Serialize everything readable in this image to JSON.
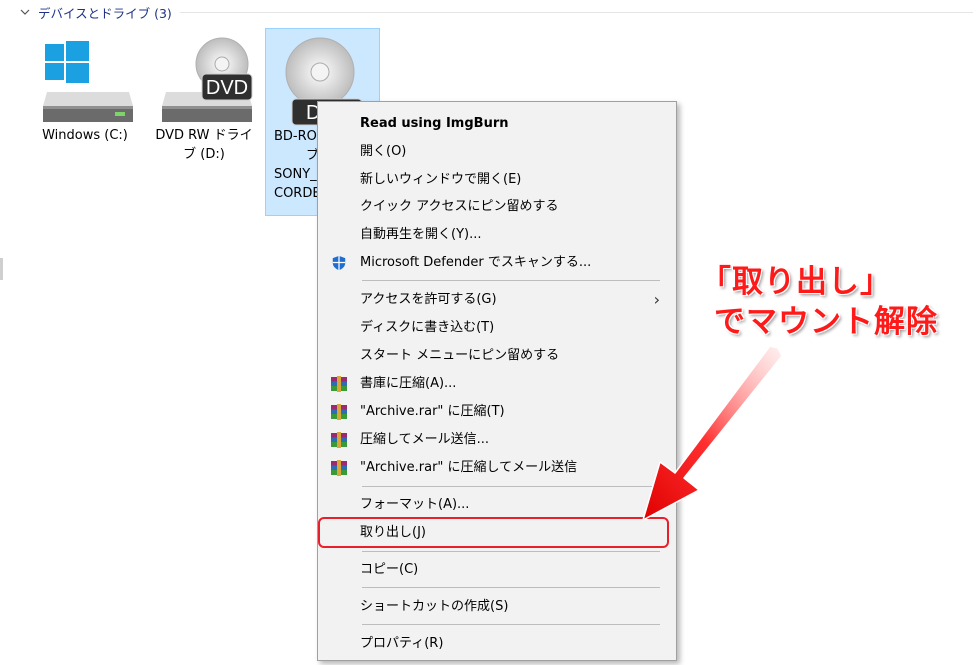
{
  "section": {
    "title": "デバイスとドライブ (3)"
  },
  "drives": [
    {
      "label": "Windows (C:)"
    },
    {
      "label": "DVD RW ドライブ (D:)",
      "badge": "DVD"
    },
    {
      "label": "BD-ROM ドライブ SONY_ RECORDER",
      "visible_label": [
        "BD-RO",
        "ブ",
        "SONY_",
        "CORDE"
      ],
      "badge": "D"
    }
  ],
  "context_menu": {
    "items": [
      {
        "label": "Read using ImgBurn",
        "bold": true
      },
      {
        "label": "開く(O)"
      },
      {
        "label": "新しいウィンドウで開く(E)"
      },
      {
        "label": "クイック アクセスにピン留めする"
      },
      {
        "label": "自動再生を開く(Y)..."
      },
      {
        "label": "Microsoft Defender でスキャンする...",
        "icon": "defender-shield-icon"
      },
      {
        "label": "アクセスを許可する(G)",
        "submenu": true
      },
      {
        "label": "ディスクに書き込む(T)"
      },
      {
        "label": "スタート メニューにピン留めする"
      },
      {
        "label": "書庫に圧縮(A)...",
        "icon": "winrar-icon"
      },
      {
        "label": "\"Archive.rar\" に圧縮(T)",
        "icon": "winrar-icon"
      },
      {
        "label": "圧縮してメール送信...",
        "icon": "winrar-icon"
      },
      {
        "label": "\"Archive.rar\" に圧縮してメール送信",
        "icon": "winrar-icon"
      },
      {
        "label": "フォーマット(A)..."
      },
      {
        "label": "取り出し(J)",
        "highlighted": true
      },
      {
        "label": "コピー(C)"
      },
      {
        "label": "ショートカットの作成(S)"
      },
      {
        "label": "プロパティ(R)"
      }
    ],
    "submenu_arrow": "›"
  },
  "annotation": {
    "line1": "「取り出し」",
    "line2": "でマウント解除",
    "color": "#ff1a1a"
  },
  "colors": {
    "header_text": "#1e3287",
    "selection_bg": "#cce8ff",
    "selection_border": "#99d1ff",
    "menu_bg": "#f2f2f2",
    "highlight_border": "#e8202a"
  }
}
